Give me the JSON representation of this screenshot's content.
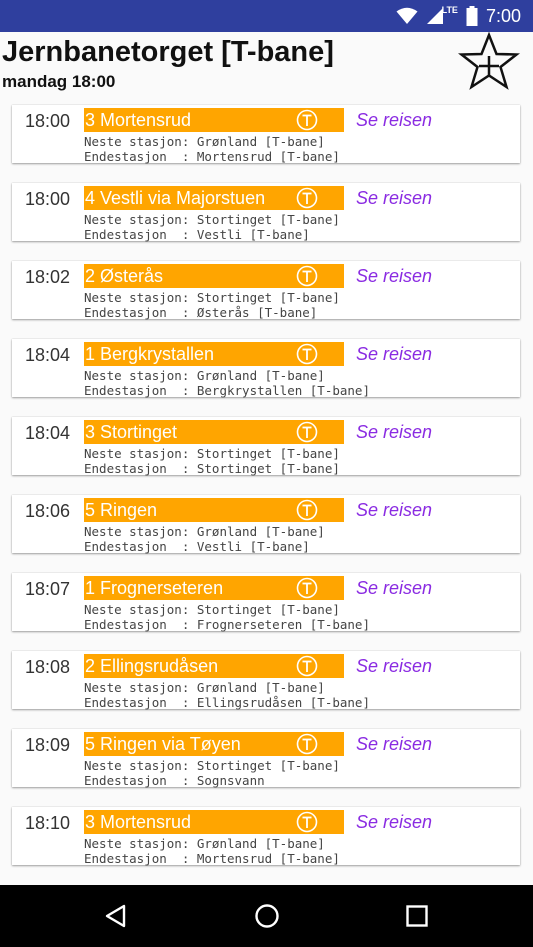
{
  "status_bar": {
    "time": "7:00",
    "network": "LTE"
  },
  "header": {
    "title": "Jernbanetorget [T-bane]",
    "subtitle": "mandag 18:00"
  },
  "departures": [
    {
      "time": "18:00",
      "line": "3 Mortensrud",
      "action": "Se reisen",
      "next_stop": "Neste stasjon: Grønland [T-bane]",
      "destination": "Endestasjon  : Mortensrud [T-bane]"
    },
    {
      "time": "18:00",
      "line": "4 Vestli via Majorstuen",
      "action": "Se reisen",
      "next_stop": "Neste stasjon: Stortinget [T-bane]",
      "destination": "Endestasjon  : Vestli [T-bane]"
    },
    {
      "time": "18:02",
      "line": "2 Østerås",
      "action": "Se reisen",
      "next_stop": "Neste stasjon: Stortinget [T-bane]",
      "destination": "Endestasjon  : Østerås [T-bane]"
    },
    {
      "time": "18:04",
      "line": "1 Bergkrystallen",
      "action": "Se reisen",
      "next_stop": "Neste stasjon: Grønland [T-bane]",
      "destination": "Endestasjon  : Bergkrystallen [T-bane]"
    },
    {
      "time": "18:04",
      "line": "3 Stortinget",
      "action": "Se reisen",
      "next_stop": "Neste stasjon: Stortinget [T-bane]",
      "destination": "Endestasjon  : Stortinget [T-bane]"
    },
    {
      "time": "18:06",
      "line": "5 Ringen",
      "action": "Se reisen",
      "next_stop": "Neste stasjon: Grønland [T-bane]",
      "destination": "Endestasjon  : Vestli [T-bane]"
    },
    {
      "time": "18:07",
      "line": "1 Frognerseteren",
      "action": "Se reisen",
      "next_stop": "Neste stasjon: Stortinget [T-bane]",
      "destination": "Endestasjon  : Frognerseteren [T-bane]"
    },
    {
      "time": "18:08",
      "line": "2 Ellingsrudåsen",
      "action": "Se reisen",
      "next_stop": "Neste stasjon: Grønland [T-bane]",
      "destination": "Endestasjon  : Ellingsrudåsen [T-bane]"
    },
    {
      "time": "18:09",
      "line": "5 Ringen via Tøyen",
      "action": "Se reisen",
      "next_stop": "Neste stasjon: Stortinget [T-bane]",
      "destination": "Endestasjon  : Sognsvann"
    },
    {
      "time": "18:10",
      "line": "3 Mortensrud",
      "action": "Se reisen",
      "next_stop": "Neste stasjon: Grønland [T-bane]",
      "destination": "Endestasjon  : Mortensrud [T-bane]"
    }
  ],
  "icons": {
    "favorite_add": "star-plus-icon",
    "line_badge": "t-bane-icon",
    "nav_back": "back-icon",
    "nav_home": "home-icon",
    "nav_recents": "recents-icon"
  },
  "colors": {
    "status_bar": "#2f3f9e",
    "line_bar": "#ffa500",
    "action_link": "#8a2be2",
    "nav_bar": "#000000"
  }
}
